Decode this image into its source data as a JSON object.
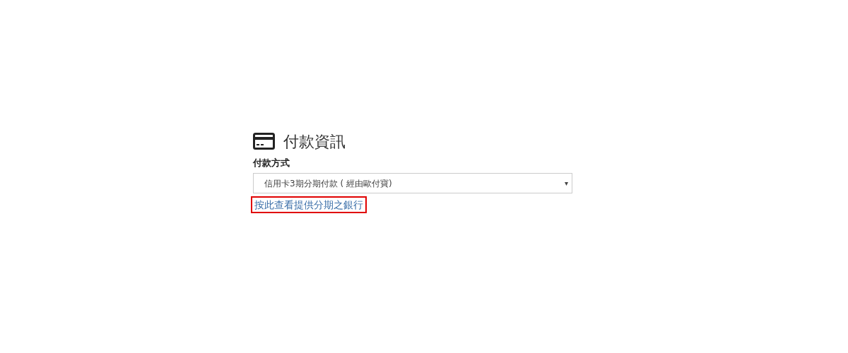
{
  "section": {
    "title": "付款資訊"
  },
  "payment_method": {
    "label": "付款方式",
    "value": "信用卡3期分期付款 ( 經由歐付寶)",
    "arrow": "▾"
  },
  "bank_link": {
    "text": "按此查看提供分期之銀行",
    "highlighted": true
  }
}
